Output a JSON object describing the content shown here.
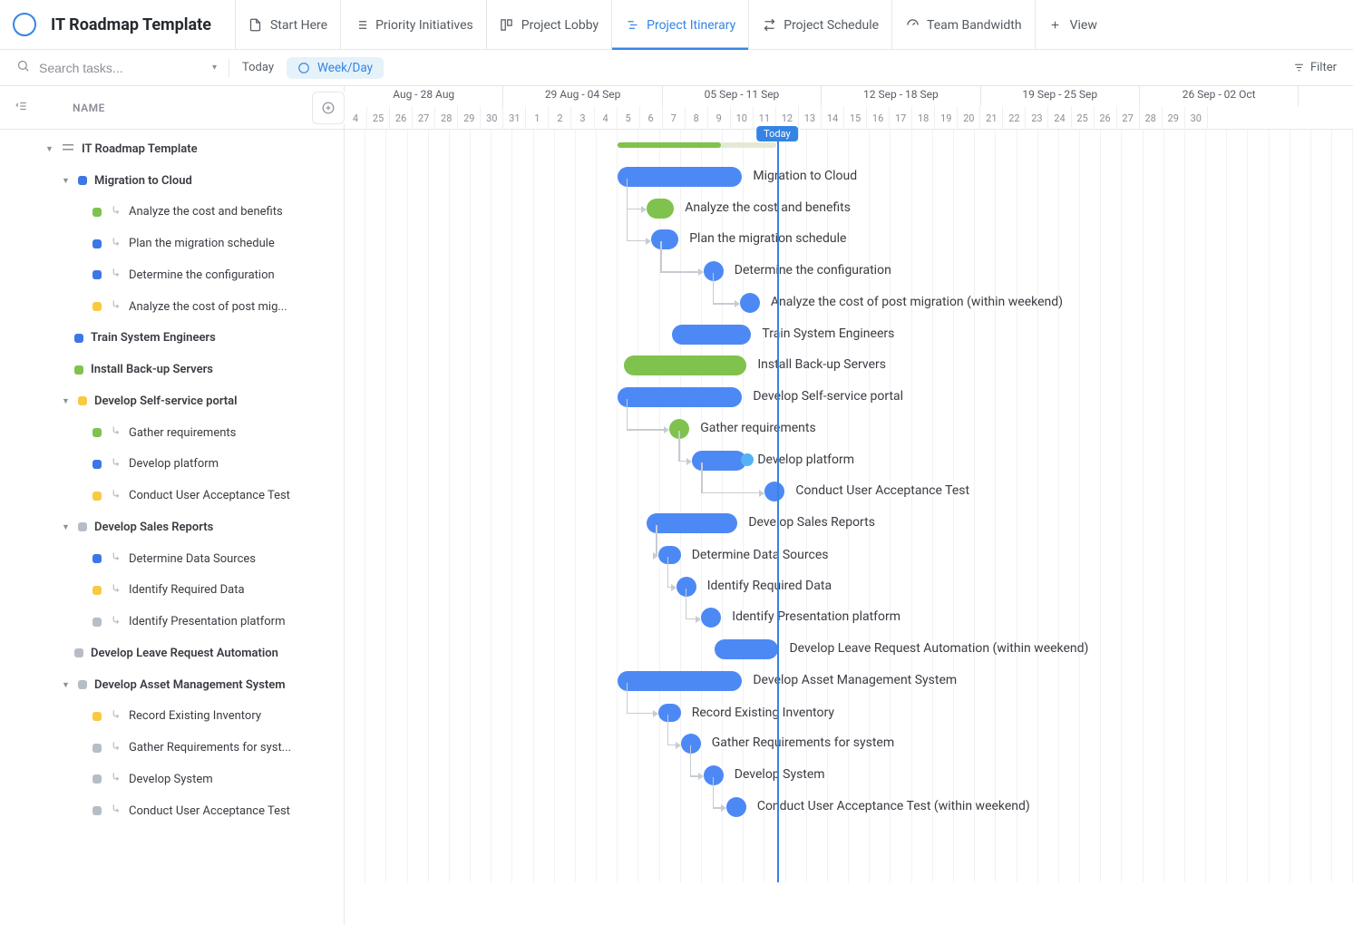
{
  "header": {
    "title": "IT Roadmap Template",
    "tabs": [
      {
        "label": "Start Here",
        "icon": "doc-icon",
        "active": false
      },
      {
        "label": "Priority Initiatives",
        "icon": "list-icon",
        "active": false
      },
      {
        "label": "Project Lobby",
        "icon": "board-icon",
        "active": false
      },
      {
        "label": "Project Itinerary",
        "icon": "gantt-icon",
        "active": true
      },
      {
        "label": "Project Schedule",
        "icon": "route-icon",
        "active": false
      },
      {
        "label": "Team Bandwidth",
        "icon": "gauge-icon",
        "active": false
      },
      {
        "label": "View",
        "icon": "plus-icon",
        "active": false
      }
    ]
  },
  "toolbar": {
    "search_placeholder": "Search tasks...",
    "today_label": "Today",
    "weekday_label": "Week/Day",
    "filter_label": "Filter"
  },
  "columns": {
    "name_header": "NAME"
  },
  "timeline": {
    "weeks": [
      "Aug - 28 Aug",
      "29 Aug - 04 Sep",
      "05 Sep - 11 Sep",
      "12 Sep - 18 Sep",
      "19 Sep - 25 Sep",
      "26 Sep - 02 Oct"
    ],
    "days": [
      "4",
      "25",
      "26",
      "27",
      "28",
      "29",
      "30",
      "31",
      "1",
      "2",
      "3",
      "4",
      "5",
      "6",
      "7",
      "8",
      "9",
      "10",
      "11",
      "12",
      "13",
      "14",
      "15",
      "16",
      "17",
      "18",
      "19",
      "20",
      "21",
      "22",
      "23",
      "24",
      "25",
      "26",
      "27",
      "28",
      "29",
      "30"
    ],
    "today_label": "Today",
    "today_col_index": 19
  },
  "tasks": [
    {
      "depth": 1,
      "label": "IT Roadmap Template",
      "color": null,
      "expandable": true,
      "icon": "list"
    },
    {
      "depth": 2,
      "label": "Migration to Cloud",
      "color": "blue-d",
      "expandable": true
    },
    {
      "depth": 3,
      "label": "Analyze the cost and benefits",
      "color": "green",
      "sub": true
    },
    {
      "depth": 3,
      "label": "Plan the migration schedule",
      "color": "blue-d",
      "sub": true
    },
    {
      "depth": 3,
      "label": "Determine the configuration",
      "color": "blue-d",
      "sub": true
    },
    {
      "depth": 3,
      "label": "Analyze the cost of post mig...",
      "color": "yellow",
      "sub": true
    },
    {
      "depth": 2,
      "label": "Train System Engineers",
      "color": "blue-d"
    },
    {
      "depth": 2,
      "label": "Install Back-up Servers",
      "color": "green"
    },
    {
      "depth": 2,
      "label": "Develop Self-service portal",
      "color": "yellow",
      "expandable": true
    },
    {
      "depth": 3,
      "label": "Gather requirements",
      "color": "green",
      "sub": true
    },
    {
      "depth": 3,
      "label": "Develop platform",
      "color": "blue-d",
      "sub": true
    },
    {
      "depth": 3,
      "label": "Conduct User Acceptance Test",
      "color": "yellow",
      "sub": true
    },
    {
      "depth": 2,
      "label": "Develop Sales Reports",
      "color": "gray",
      "expandable": true
    },
    {
      "depth": 3,
      "label": "Determine Data Sources",
      "color": "blue-d",
      "sub": true
    },
    {
      "depth": 3,
      "label": "Identify Required Data",
      "color": "yellow",
      "sub": true
    },
    {
      "depth": 3,
      "label": "Identify Presentation platform",
      "color": "gray",
      "sub": true
    },
    {
      "depth": 2,
      "label": "Develop Leave Request Automation",
      "color": "gray"
    },
    {
      "depth": 2,
      "label": "Develop Asset Management System",
      "color": "gray",
      "expandable": true
    },
    {
      "depth": 3,
      "label": "Record Existing Inventory",
      "color": "yellow",
      "sub": true
    },
    {
      "depth": 3,
      "label": "Gather Requirements for syst...",
      "color": "gray",
      "sub": true
    },
    {
      "depth": 3,
      "label": "Develop System",
      "color": "gray",
      "sub": true
    },
    {
      "depth": 3,
      "label": "Conduct User Acceptance Test",
      "color": "gray",
      "sub": true
    }
  ],
  "gantt": {
    "progress": {
      "col": 12,
      "width_cols": 7.0,
      "pct": 65
    },
    "bars": [
      {
        "row": 1,
        "col": 12.0,
        "width": 5.5,
        "color": "blue",
        "label": "Migration to Cloud"
      },
      {
        "row": 2,
        "col": 13.3,
        "width": 1.2,
        "color": "green",
        "label": "Analyze the cost and benefits",
        "conn_from": 1
      },
      {
        "row": 3,
        "col": 13.5,
        "width": 1.2,
        "color": "blue",
        "label": "Plan the migration schedule",
        "conn_from": 1
      },
      {
        "row": 4,
        "col": 15.8,
        "width": 1.0,
        "color": "blue",
        "shape": "circle",
        "label": "Determine the configuration",
        "conn_from": 3
      },
      {
        "row": 5,
        "col": 17.4,
        "width": 1.0,
        "color": "blue",
        "shape": "circle",
        "label": "Analyze the cost of post migration (within weekend)",
        "conn_from": 4
      },
      {
        "row": 6,
        "col": 14.4,
        "width": 3.5,
        "color": "blue",
        "label": "Train System Engineers"
      },
      {
        "row": 7,
        "col": 12.3,
        "width": 5.4,
        "color": "green",
        "label": "Install Back-up Servers"
      },
      {
        "row": 8,
        "col": 12.0,
        "width": 5.5,
        "color": "blue",
        "label": "Develop Self-service portal"
      },
      {
        "row": 9,
        "col": 14.3,
        "width": 1.0,
        "color": "green",
        "shape": "circle",
        "label": "Gather requirements",
        "conn_from": 8
      },
      {
        "row": 10,
        "col": 15.3,
        "width": 2.4,
        "color": "blue",
        "label": "Develop platform",
        "conn_from": 9,
        "extra_dot": true
      },
      {
        "row": 11,
        "col": 18.5,
        "width": 1.0,
        "color": "blue",
        "shape": "circle",
        "label": "Conduct User Acceptance Test",
        "conn_from": 10
      },
      {
        "row": 12,
        "col": 13.3,
        "width": 4.0,
        "color": "blue",
        "label": "Develop Sales Reports"
      },
      {
        "row": 13,
        "col": 13.8,
        "width": 1.0,
        "color": "blue",
        "label": "Determine Data Sources",
        "conn_from": 12,
        "small": true
      },
      {
        "row": 14,
        "col": 14.6,
        "width": 1.0,
        "color": "blue",
        "shape": "circle",
        "label": "Identify Required Data",
        "conn_from": 13
      },
      {
        "row": 15,
        "col": 15.7,
        "width": 1.0,
        "color": "blue",
        "shape": "circle",
        "label": "Identify Presentation platform",
        "conn_from": 14
      },
      {
        "row": 16,
        "col": 16.3,
        "width": 2.8,
        "color": "blue",
        "label": "Develop Leave Request Automation (within weekend)"
      },
      {
        "row": 17,
        "col": 12.0,
        "width": 5.5,
        "color": "blue",
        "label": "Develop Asset Management System"
      },
      {
        "row": 18,
        "col": 13.8,
        "width": 1.0,
        "color": "blue",
        "label": "Record Existing Inventory",
        "conn_from": 17,
        "small": true
      },
      {
        "row": 19,
        "col": 14.8,
        "width": 1.0,
        "color": "blue",
        "shape": "circle",
        "label": "Gather Requirements for system",
        "conn_from": 18
      },
      {
        "row": 20,
        "col": 15.8,
        "width": 1.0,
        "color": "blue",
        "shape": "circle",
        "label": "Develop System",
        "conn_from": 19
      },
      {
        "row": 21,
        "col": 16.8,
        "width": 1.0,
        "color": "blue",
        "shape": "circle",
        "label": "Conduct User Acceptance Test (within weekend)",
        "conn_from": 20
      }
    ]
  }
}
